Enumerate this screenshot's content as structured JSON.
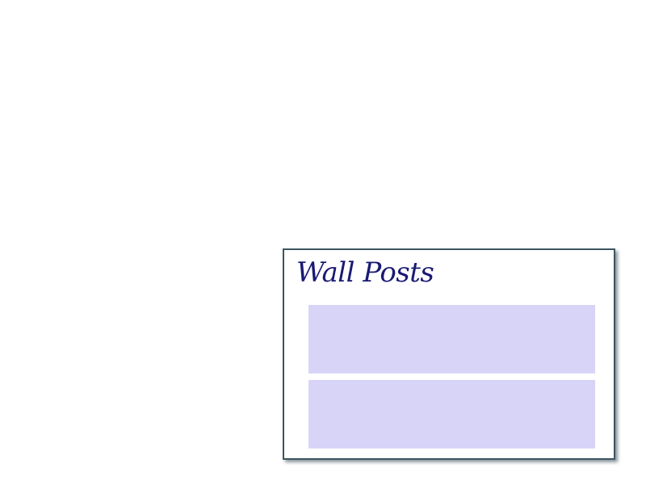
{
  "wall": {
    "title": "Wall Posts",
    "posts": [
      {
        "text": ""
      },
      {
        "text": ""
      }
    ]
  },
  "colors": {
    "title": "#1a1a73",
    "panel_border": "#3d5560",
    "post_background": "#d8d4f7"
  }
}
